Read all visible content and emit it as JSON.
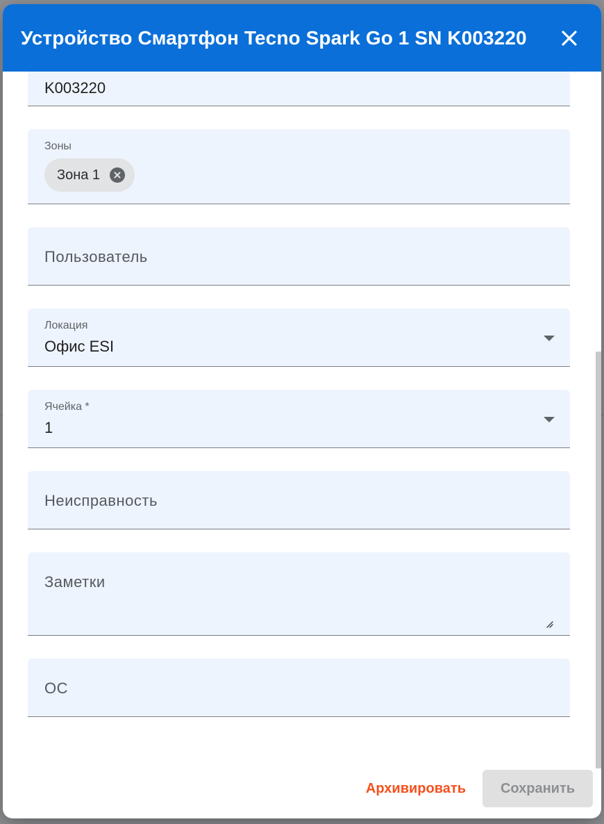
{
  "dialog": {
    "title": "Устройство Смартфон Tecno Spark Go 1 SN K003220",
    "close_icon": "close-icon"
  },
  "fields": {
    "serial": {
      "value": "K003220"
    },
    "zones": {
      "label": "Зоны",
      "chips": [
        {
          "label": "Зона 1"
        }
      ]
    },
    "user": {
      "placeholder": "Пользователь"
    },
    "location": {
      "label": "Локация",
      "value": "Офис ESI"
    },
    "cell": {
      "label": "Ячейка *",
      "value": "1"
    },
    "malfunction": {
      "placeholder": "Неисправность"
    },
    "notes": {
      "placeholder": "Заметки"
    },
    "os": {
      "placeholder": "ОС"
    }
  },
  "footer": {
    "archive_label": "Архивировать",
    "save_label": "Сохранить"
  },
  "colors": {
    "header": "#0a6fd8",
    "field_bg": "#eef4fd",
    "archive": "#f4511e",
    "save_disabled_bg": "#e0e0e0"
  }
}
